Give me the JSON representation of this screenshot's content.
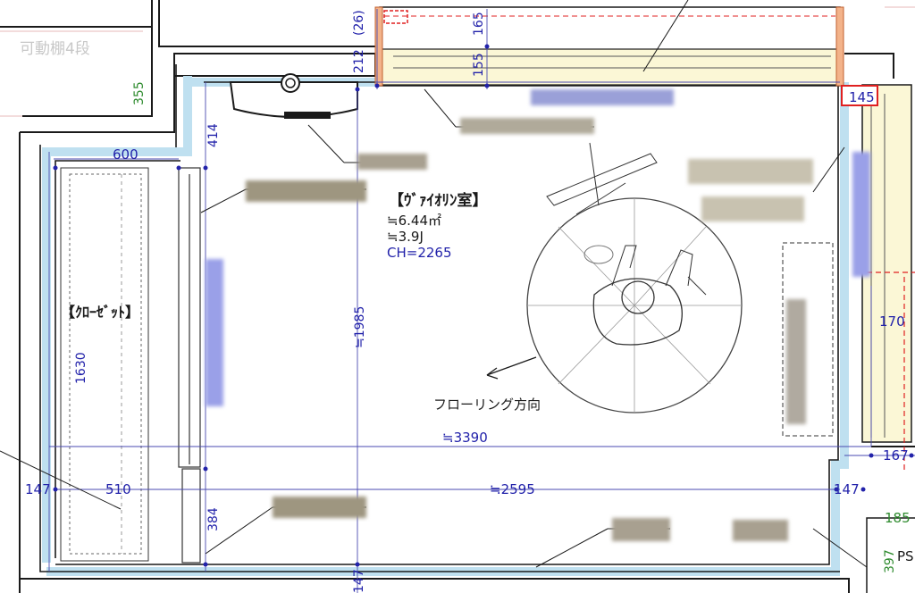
{
  "room": {
    "name": "【ｳﾞｧｲｵﾘﾝ室】",
    "area_m2": "≒6.44㎡",
    "area_tatami": "≒3.9J",
    "ceiling_height": "CH=2265"
  },
  "closet": {
    "name": "【ｸﾛｰｾﾞｯﾄ】"
  },
  "flooring_direction": "フローリング方向",
  "top_left_label": "可動棚4段",
  "ps_label": "PS",
  "dimensions": {
    "d26": "(26)",
    "d212": "212",
    "d165": "165",
    "d155": "155",
    "d355": "355",
    "d414": "414",
    "d600": "600",
    "d145": "145",
    "d1985": "≒1985",
    "d170": "170",
    "d1630": "1630",
    "d3390": "≒3390",
    "d167": "167",
    "d147_left": "147",
    "d510": "510",
    "d2595": "≒2595",
    "d147_right": "147",
    "d384": "384",
    "d185": "185",
    "d147_bottom": "147",
    "d397": "397"
  },
  "colors": {
    "wall_outline": "#1a1a1a",
    "insulation": "#d8ecf6",
    "dimension_text": "#2222aa",
    "green_dimension": "#2e8b2e",
    "red_marker": "#e02020",
    "window_fill": "#fbf7d6",
    "redacted": "#9aa0c8"
  }
}
